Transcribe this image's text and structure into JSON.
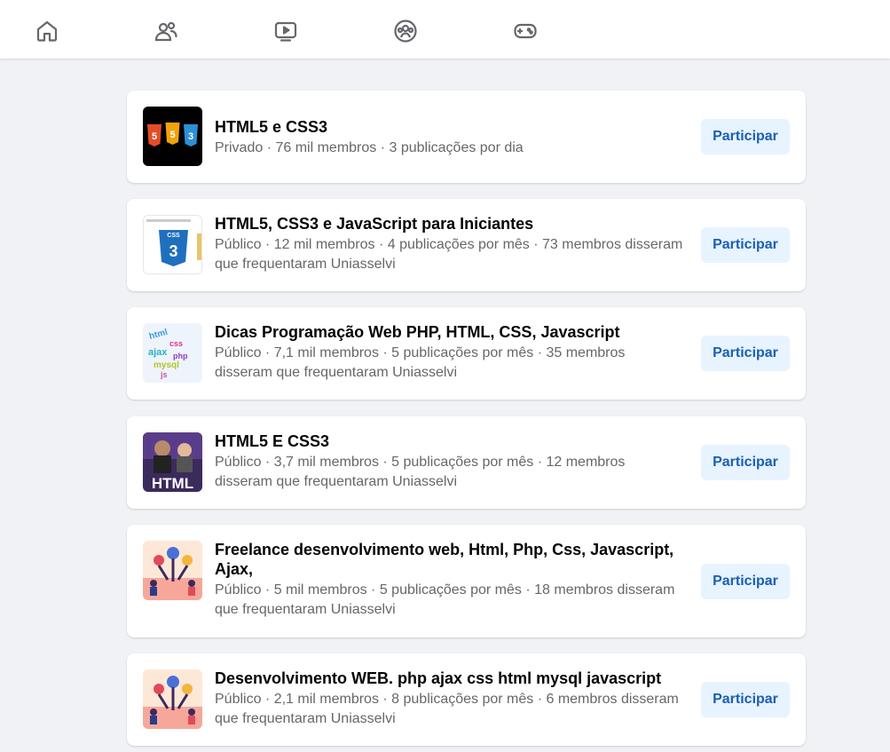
{
  "nav": {
    "items": [
      {
        "icon": "home-icon"
      },
      {
        "icon": "friends-icon"
      },
      {
        "icon": "video-icon"
      },
      {
        "icon": "groups-icon"
      },
      {
        "icon": "gaming-icon"
      }
    ]
  },
  "groups": [
    {
      "name": "HTML5 e CSS3",
      "meta": "Privado · 76 mil membros · 3 publicações por dia",
      "button": "Participar",
      "thumbnail": "html-css-js-logos"
    },
    {
      "name": "HTML5, CSS3 e JavaScript para Iniciantes",
      "meta": "Público · 12 mil membros · 4 publicações por mês · 73 membros disseram que frequentaram Uniasselvi",
      "button": "Participar",
      "thumbnail": "css3-shield"
    },
    {
      "name": "Dicas Programação Web PHP, HTML, CSS, Javascript",
      "meta": "Público · 7,1 mil membros · 5 publicações por mês · 35 membros disseram que frequentaram Uniasselvi",
      "button": "Participar",
      "thumbnail": "word-cloud"
    },
    {
      "name": "HTML5 E CSS3",
      "meta": "Público · 3,7 mil membros · 5 publicações por mês · 12 membros disseram que frequentaram Uniasselvi",
      "button": "Participar",
      "thumbnail": "html-people-photo"
    },
    {
      "name": "Freelance desenvolvimento web, Html, Php, Css, Javascript, Ajax,",
      "meta": "Público · 5 mil membros · 5 publicações por mês · 18 membros disseram que frequentaram Uniasselvi",
      "button": "Participar",
      "thumbnail": "team-illustration"
    },
    {
      "name": "Desenvolvimento WEB. php ajax css html mysql javascript",
      "meta": "Público · 2,1 mil membros · 8 publicações por mês · 6 membros disseram que frequentaram Uniasselvi",
      "button": "Participar",
      "thumbnail": "team-illustration"
    }
  ],
  "colors": {
    "accent": "#1a5fb4",
    "button_bg": "#e7f3ff",
    "page_bg": "#f0f2f5",
    "secondary_text": "#65676b"
  }
}
